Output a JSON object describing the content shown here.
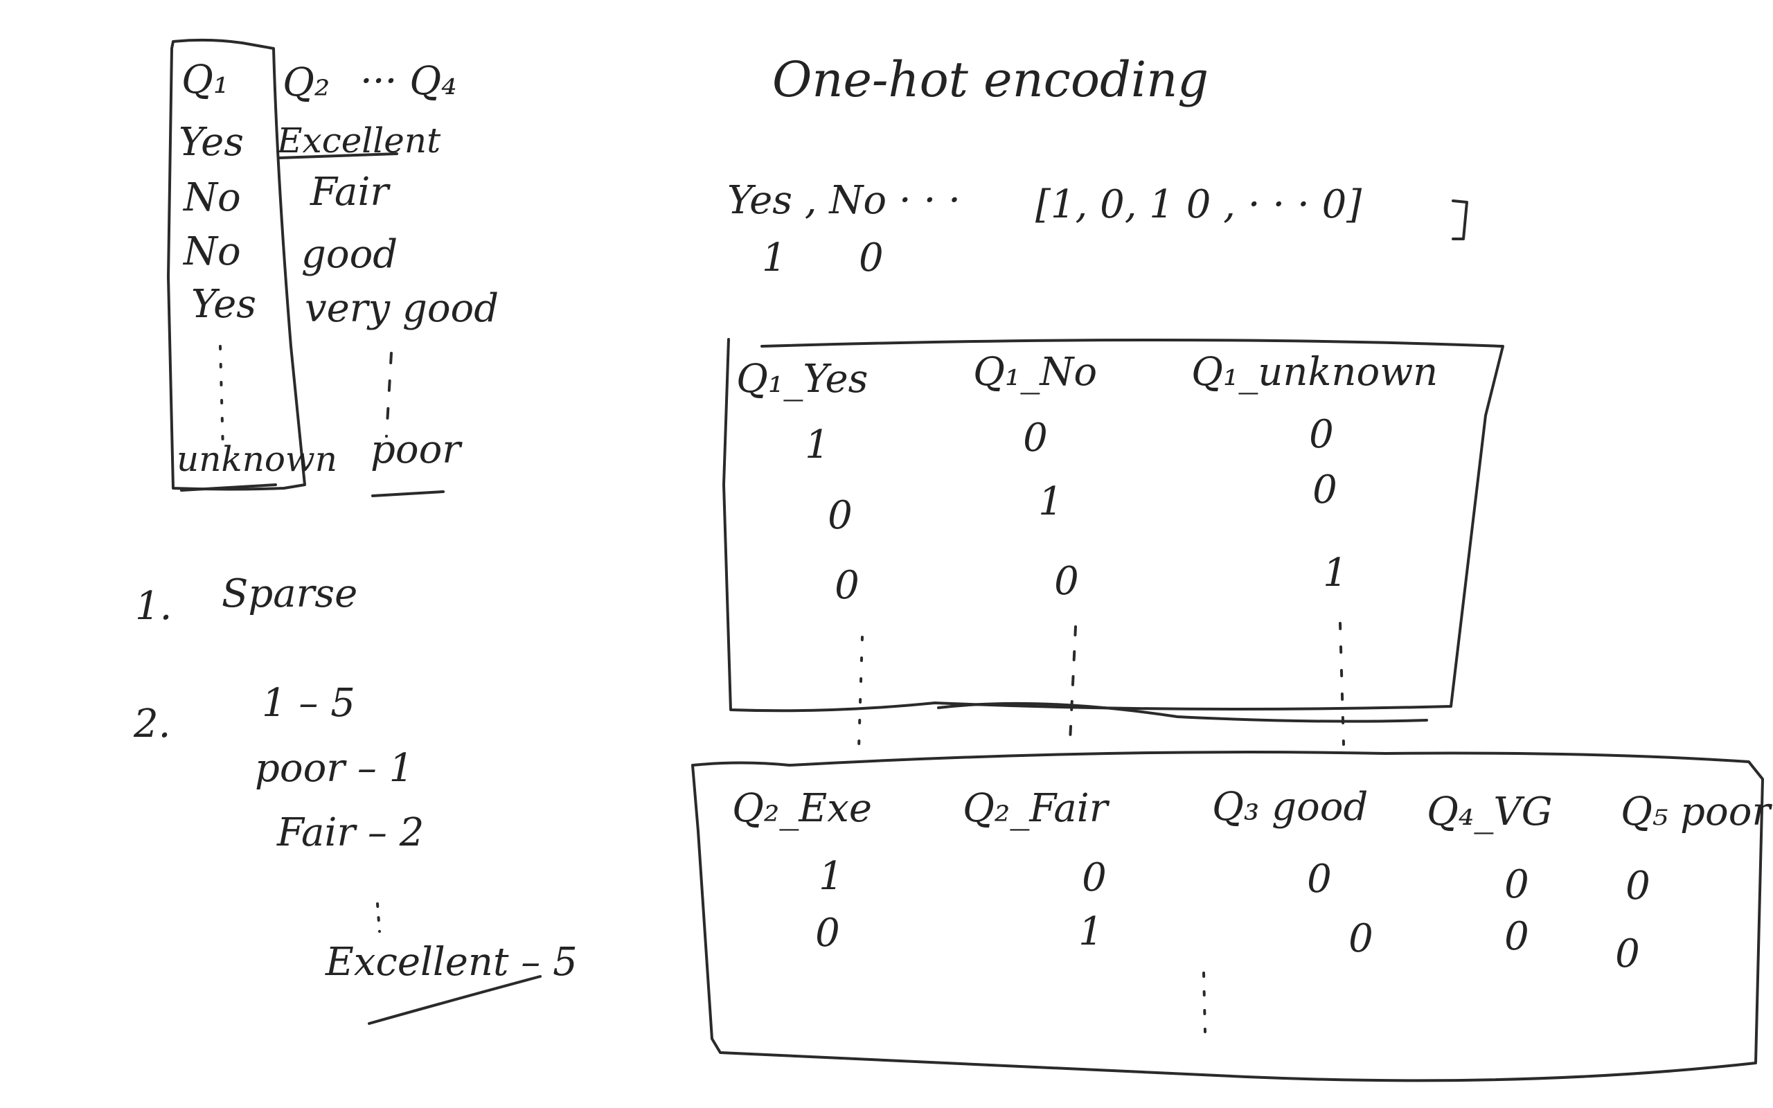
{
  "left_panel": {
    "col1_header": "Q₁",
    "col2_header": "Q₂",
    "col3_header": "··· Q₄",
    "col1_values": [
      "Yes",
      "No",
      "No",
      "Yes",
      "unknown"
    ],
    "col2_values": [
      "Excellent",
      "Fair",
      "good",
      "very good",
      "poor"
    ]
  },
  "title": "One-hot  encoding",
  "yes_no_label": "Yes , No  · · ·",
  "vector_label": "[1, 0, 1 0 ,  · · ·  0]",
  "yes_no_codes": [
    "1",
    "0"
  ],
  "notes": {
    "item1_number": "1.",
    "item1_text": "Sparse",
    "item2_number": "2.",
    "item2_lines": [
      "1 – 5",
      "poor – 1",
      "Fair – 2",
      "Excellent – 5"
    ]
  },
  "table1": {
    "headers": [
      "Q₁_Yes",
      "Q₁_No",
      "Q₁_unknown"
    ],
    "rows": [
      [
        "1",
        "0",
        "0"
      ],
      [
        "0",
        "1",
        "0"
      ],
      [
        "0",
        "0",
        "1"
      ]
    ]
  },
  "table2": {
    "headers": [
      "Q₂_Exe",
      "Q₂_Fair",
      "Q₃ good",
      "Q₄_VG",
      "Q₅ poor"
    ],
    "rows": [
      [
        "1",
        "0",
        "0",
        "0",
        "0"
      ],
      [
        "0",
        "1",
        "0",
        "0",
        "0"
      ]
    ]
  },
  "ink_color": "#232323"
}
